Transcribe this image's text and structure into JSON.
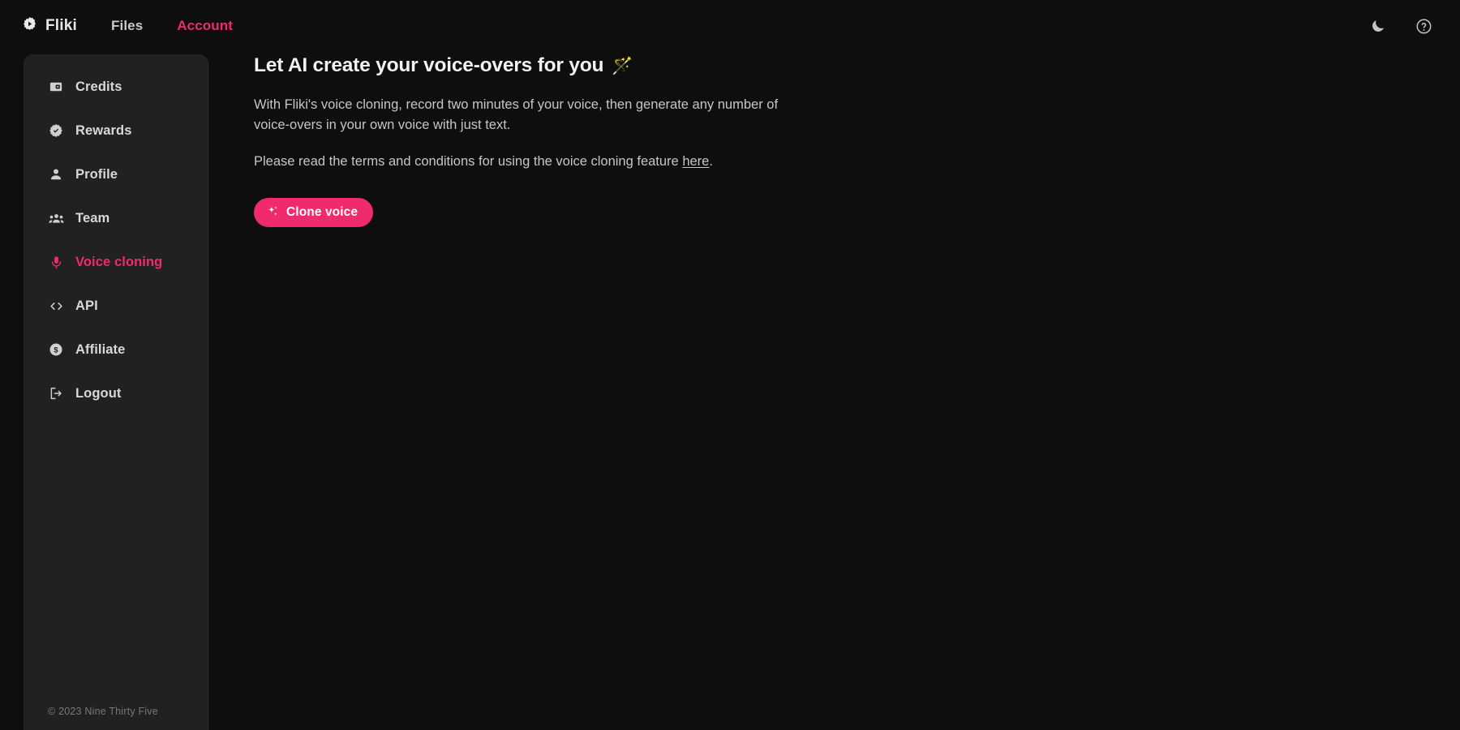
{
  "app": {
    "brand_name": "Fliki",
    "brand_icon": "fliki-play-badge-icon",
    "theme": {
      "background": "#0e0e0e",
      "panel": "#212121",
      "accent": "#ef2a6d",
      "text": "#d8d8d8"
    }
  },
  "topbar": {
    "nav": [
      {
        "label": "Files",
        "icon": "",
        "active": false
      },
      {
        "label": "Account",
        "icon": "",
        "active": true
      }
    ],
    "actions": [
      {
        "name": "theme-toggle",
        "icon": "moon-icon"
      },
      {
        "name": "help",
        "icon": "question-circle-icon"
      }
    ]
  },
  "sidebar": {
    "items": [
      {
        "label": "Credits",
        "icon": "credit-card-icon",
        "active": false
      },
      {
        "label": "Rewards",
        "icon": "verified-badge-icon",
        "active": false
      },
      {
        "label": "Profile",
        "icon": "person-icon",
        "active": false
      },
      {
        "label": "Team",
        "icon": "people-group-icon",
        "active": false
      },
      {
        "label": "Voice cloning",
        "icon": "microphone-icon",
        "active": true
      },
      {
        "label": "API",
        "icon": "code-brackets-icon",
        "active": false
      },
      {
        "label": "Affiliate",
        "icon": "dollar-circle-icon",
        "active": false
      },
      {
        "label": "Logout",
        "icon": "logout-arrow-icon",
        "active": false
      }
    ],
    "footer": "© 2023 Nine Thirty Five"
  },
  "main": {
    "title": "Let AI create your voice-overs for you",
    "title_emoji": "🪄",
    "paragraph_1": "With Fliki's voice cloning, record two minutes of your voice, then generate any number of voice-overs in your own voice with just text.",
    "paragraph_2_before": "Please read the terms and conditions for using the voice cloning feature ",
    "paragraph_2_link": "here",
    "paragraph_2_after": ".",
    "cta_label": "Clone voice",
    "cta_icon": "sparkles-icon"
  }
}
